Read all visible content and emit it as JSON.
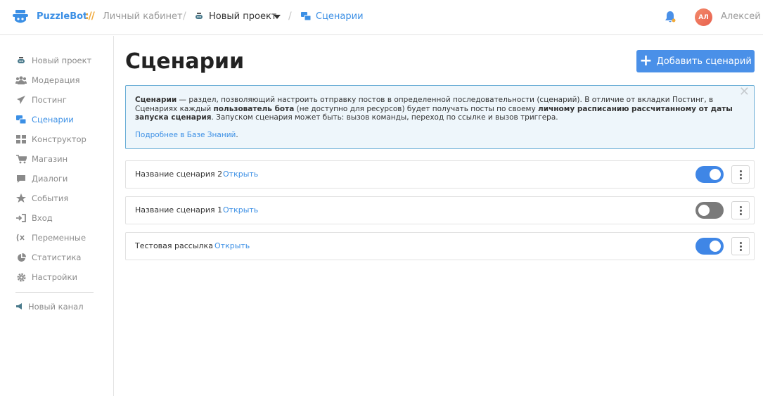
{
  "header": {
    "brand": "PuzzleBot",
    "brand_separator": "://",
    "cabinet": "Личный кабинет",
    "project": "Новый проект",
    "section": "Сценарии",
    "user_initials": "АЛ",
    "user_name": "Алексей",
    "colors": {
      "accent": "#3b8fe5",
      "separator": "#f0a93a"
    }
  },
  "sidebar": {
    "items": [
      {
        "label": "Новый проект",
        "icon": "bot-icon"
      },
      {
        "label": "Модерация",
        "icon": "users-icon"
      },
      {
        "label": "Постинг",
        "icon": "paper-plane-icon"
      },
      {
        "label": "Сценарии",
        "icon": "scenarios-icon"
      },
      {
        "label": "Конструктор",
        "icon": "grid-icon"
      },
      {
        "label": "Магазин",
        "icon": "cart-icon"
      },
      {
        "label": "Диалоги",
        "icon": "chat-icon"
      },
      {
        "label": "События",
        "icon": "star-icon"
      },
      {
        "label": "Вход",
        "icon": "sign-in-icon"
      },
      {
        "label": "Переменные",
        "icon": "variables-icon"
      },
      {
        "label": "Статистика",
        "icon": "pie-chart-icon"
      },
      {
        "label": "Настройки",
        "icon": "gear-icon"
      }
    ],
    "new_channel": "Новый канал"
  },
  "main": {
    "title": "Сценарии",
    "add_button": "Добавить сценарий",
    "info": {
      "b1": "Сценарии",
      "t1": " — раздел, позволяющий настроить отправку постов в определенной последовательности (сценарий). В отличие от вкладки Постинг, в Сценариях каждый ",
      "b2": "пользователь бота",
      "t2": " (не доступно для ресурсов) будет получать посты по своему ",
      "b3": "личному расписанию рассчитанному от даты запуска сценария",
      "t3": ". Запуском сценария может быть: вызов команды, переход по ссылке и вызов триггера.",
      "link": "Подробнее в Базе Знаний",
      "link_dot": "."
    },
    "scenarios": [
      {
        "name": "Название сценария 2",
        "open": "Открыть",
        "enabled": true
      },
      {
        "name": "Название сценария 1",
        "open": "Открыть",
        "enabled": false
      },
      {
        "name": "Тестовая рассылка",
        "open": "Открыть",
        "enabled": true
      }
    ]
  }
}
